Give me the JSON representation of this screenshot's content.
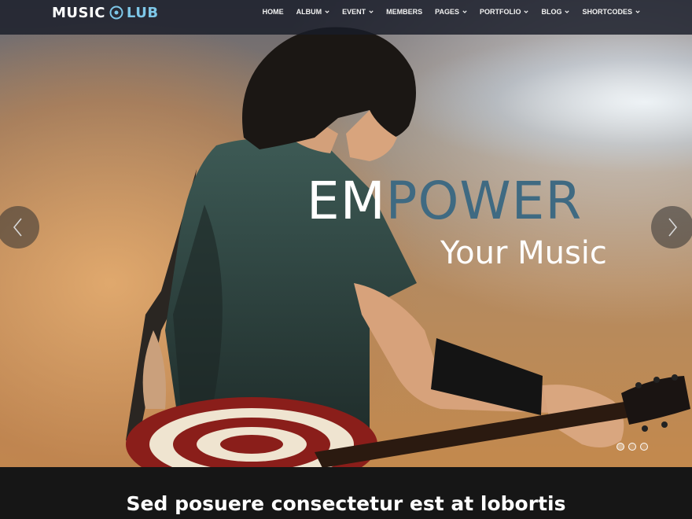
{
  "brand": {
    "word1": "MUSIC",
    "word2": "LUB",
    "accent": "#7ec7e8"
  },
  "nav": {
    "items": [
      {
        "label": "HOME",
        "has_dropdown": false
      },
      {
        "label": "ALBUM",
        "has_dropdown": true
      },
      {
        "label": "EVENT",
        "has_dropdown": true
      },
      {
        "label": "MEMBERS",
        "has_dropdown": false
      },
      {
        "label": "PAGES",
        "has_dropdown": true
      },
      {
        "label": "PORTFOLIO",
        "has_dropdown": true
      },
      {
        "label": "BLOG",
        "has_dropdown": true
      },
      {
        "label": "SHORTCODES",
        "has_dropdown": true
      }
    ]
  },
  "hero": {
    "headline_part1": "EM",
    "headline_part2": "POWER",
    "subline": "Your Music",
    "headline_accent": "#3f6a82",
    "slides_total": 3,
    "active_slide": 1,
    "image": "guitarist-concert-photo"
  },
  "intro": {
    "title": "Sed posuere consectetur est at lobortis"
  },
  "icons": {
    "logo_disc": "disc-icon",
    "prev": "chevron-left-icon",
    "next": "chevron-right-icon",
    "dropdown": "chevron-down-icon"
  }
}
